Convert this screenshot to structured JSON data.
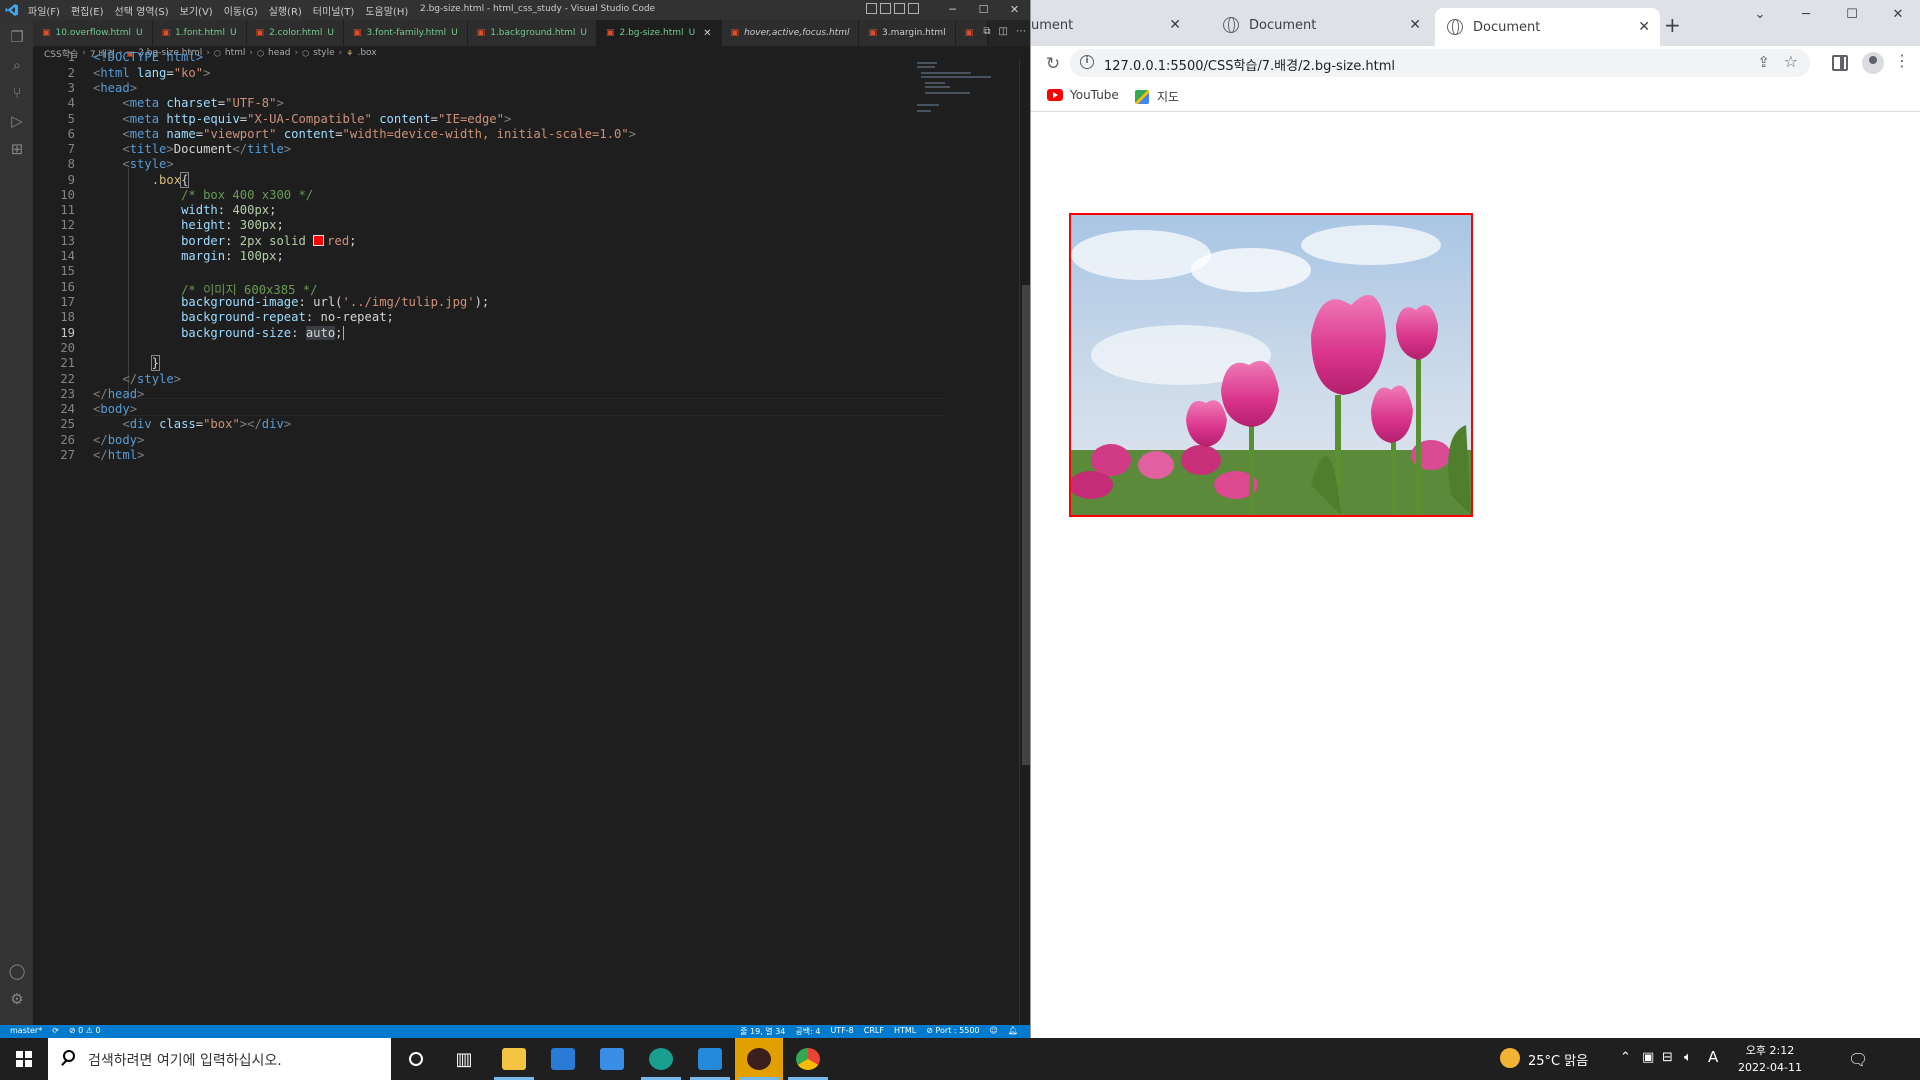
{
  "vscode": {
    "menu": [
      "파일(F)",
      "편집(E)",
      "선택 영역(S)",
      "보기(V)",
      "이동(G)",
      "실행(R)",
      "터미널(T)",
      "도움말(H)"
    ],
    "window_title": "2.bg-size.html - html_css_study - Visual Studio Code",
    "tabs": [
      {
        "name": "10.overflow.html",
        "mark": "U"
      },
      {
        "name": "1.font.html",
        "mark": "U"
      },
      {
        "name": "2.color.html",
        "mark": "U"
      },
      {
        "name": "3.font-family.html",
        "mark": "U"
      },
      {
        "name": "1.background.html",
        "mark": "U"
      },
      {
        "name": "2.bg-size.html",
        "mark": "U"
      },
      {
        "name": "hover,active,focus.html",
        "mark": ""
      },
      {
        "name": "3.margin.html",
        "mark": ""
      }
    ],
    "breadcrumb": [
      "CSS학습",
      "7.배경",
      "2.bg-size.html",
      "html",
      "head",
      "style",
      ".box"
    ],
    "line_numbers": [
      "1",
      "2",
      "3",
      "4",
      "5",
      "6",
      "7",
      "8",
      "9",
      "10",
      "11",
      "12",
      "13",
      "14",
      "15",
      "16",
      "17",
      "18",
      "19",
      "20",
      "21",
      "22",
      "23",
      "24",
      "25",
      "26",
      "27"
    ],
    "current_line": "19",
    "code": {
      "l1": "<!DOCTYPE html>",
      "l2_tag": "html",
      "l2_attr": "lang",
      "l2_val": "\"ko\"",
      "l3": "head",
      "l4_attr": "charset",
      "l4_val": "\"UTF-8\"",
      "l5_attr": "http-equiv",
      "l5_val": "\"X-UA-Compatible\"",
      "l5_attr2": "content",
      "l5_val2": "\"IE=edge\"",
      "l6_attr": "name",
      "l6_val": "\"viewport\"",
      "l6_attr2": "content",
      "l6_val2": "\"width=device-width, initial-scale=1.0\"",
      "l7_text": "Document",
      "l9_sel": ".box",
      "l10": "/* box 400 x300 */",
      "l11_prop": "width",
      "l11_val": "400px",
      "l12_prop": "height",
      "l12_val": "300px",
      "l13_prop": "border",
      "l13_val": "2px solid ",
      "l13_color": "red",
      "l14_prop": "margin",
      "l14_val": "100px",
      "l16": "/* 이미지 600x385 */",
      "l17_prop": "background-image",
      "l17_fn": "url(",
      "l17_val": "'../img/tulip.jpg'",
      "l18_prop": "background-repeat",
      "l18_val": "no-repeat",
      "l19_prop": "background-size",
      "l19_val": "auto",
      "l25_attr": "class",
      "l25_val": "\"box\""
    },
    "status": {
      "branch": "master*",
      "problems": "⊘ 0 ⚠ 0",
      "position": "줄 19, 열 34",
      "spaces": "공백: 4",
      "encoding": "UTF-8",
      "eol": "CRLF",
      "language": "HTML",
      "port": "⊘ Port : 5500"
    }
  },
  "chrome": {
    "tabs": [
      "ument",
      "Document",
      "Document"
    ],
    "url": "127.0.0.1:5500/CSS학습/7.배경/2.bg-size.html",
    "bookmarks": [
      "YouTube",
      "지도"
    ],
    "box_border_color": "#ff0000"
  },
  "taskbar": {
    "search_placeholder": "검색하려면 여기에 입력하십시오.",
    "apps": [
      "cortana-icon",
      "task-view-icon",
      "file-explorer-icon",
      "mail-icon",
      "store-icon",
      "edge-icon",
      "vscode-icon",
      "kakaotalk-icon",
      "chrome-icon"
    ],
    "weather": "25°C 맑음",
    "ime": "A",
    "time": "오후 2:12",
    "date": "2022-04-11"
  }
}
